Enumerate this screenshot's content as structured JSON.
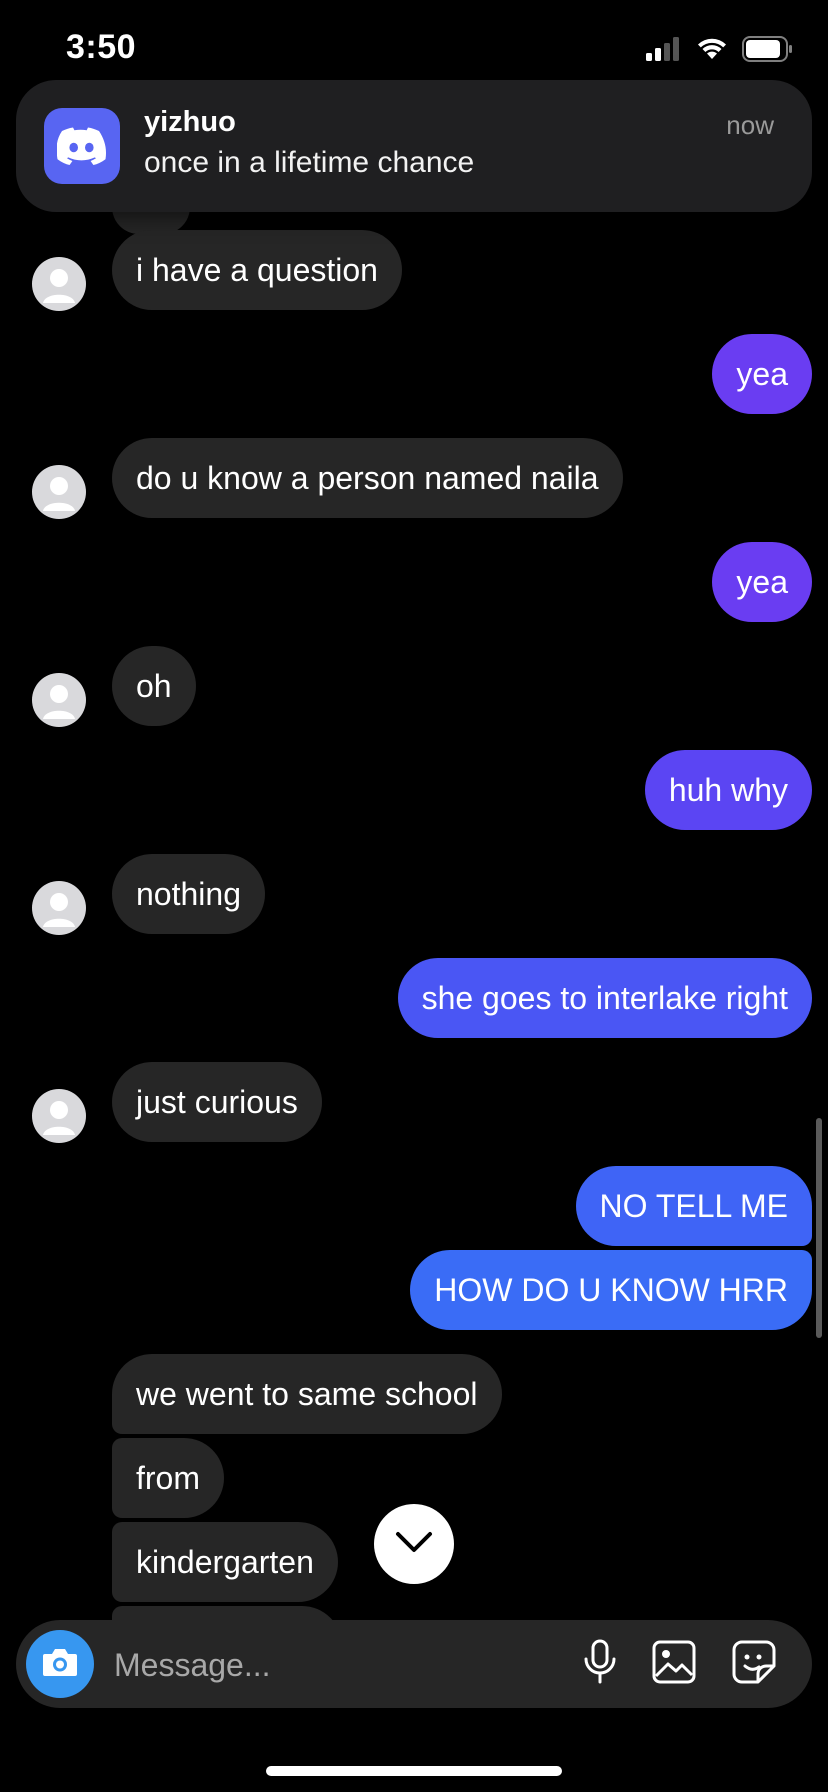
{
  "status_bar": {
    "time": "3:50"
  },
  "notification": {
    "app_icon": "discord-icon",
    "title": "yizhuo",
    "body": "once in a lifetime chance",
    "time": "now",
    "accent": "#5865f2"
  },
  "colors": {
    "incoming_bubble": "#262626",
    "outgoing_purple": "#6a3df2",
    "outgoing_blue": "#3f5af5",
    "outgoing_bright_blue": "#3a6cf6",
    "camera_button": "#3797f0"
  },
  "messages": [
    {
      "side": "in",
      "text": "i have a question"
    },
    {
      "side": "out",
      "text": "yea"
    },
    {
      "side": "in",
      "text": "do u know a person named naila"
    },
    {
      "side": "out",
      "text": "yea"
    },
    {
      "side": "in",
      "text": "oh"
    },
    {
      "side": "out",
      "text": "huh why"
    },
    {
      "side": "in",
      "text": "nothing"
    },
    {
      "side": "out",
      "text": "she goes to interlake right"
    },
    {
      "side": "in",
      "text": "just curious"
    },
    {
      "side": "out",
      "text": "NO TELL ME"
    },
    {
      "side": "out",
      "text": "HOW DO U KNOW HRR"
    },
    {
      "side": "in",
      "text": "we went to same school"
    },
    {
      "side": "in",
      "text": "from"
    },
    {
      "side": "in",
      "text": "kindergarten"
    }
  ],
  "composer": {
    "placeholder": "Message...",
    "icons": [
      "camera-icon",
      "microphone-icon",
      "image-icon",
      "sticker-icon"
    ]
  }
}
